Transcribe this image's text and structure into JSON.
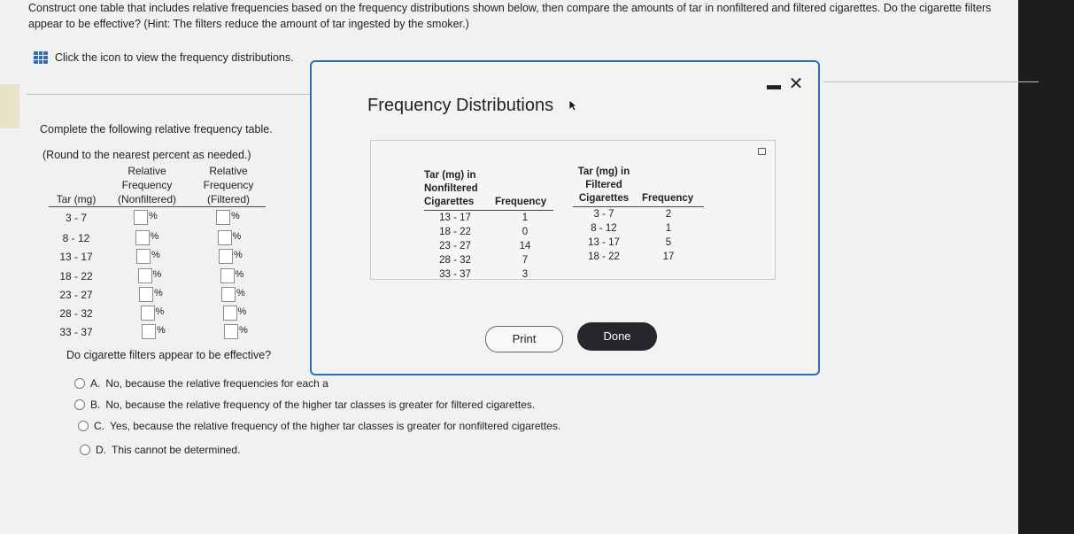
{
  "question": {
    "line1": "Construct one table that includes relative frequencies based on the frequency distributions shown below, then compare the amounts of tar in nonfiltered and filtered cigarettes. Do the cigarette filters",
    "line2": "appear to be effective? (Hint: The filters reduce the amount of tar ingested by the smoker.)"
  },
  "icon_link": {
    "icon": "table-icon",
    "text": "Click the icon to view the frequency distributions."
  },
  "instruction": "Complete the following relative frequency table.",
  "round_note": "(Round to the nearest percent as needed.)",
  "rel_table": {
    "headers": {
      "tar": "Tar (mg)",
      "nonfiltered": [
        "Relative",
        "Frequency",
        "(Nonfiltered)"
      ],
      "filtered": [
        "Relative",
        "Frequency",
        "(Filtered)"
      ]
    },
    "percent_sign": "%",
    "rows": [
      "3 - 7",
      "8 - 12",
      "13 - 17",
      "18 - 22",
      "23 - 27",
      "28 - 32",
      "33 - 37"
    ]
  },
  "effective_question": "Do cigarette filters appear to be effective?",
  "options": [
    {
      "letter": "A.",
      "text": "No, because the relative frequencies for each a"
    },
    {
      "letter": "B.",
      "text": "No, because the relative frequency of the higher tar classes is greater for filtered cigarettes."
    },
    {
      "letter": "C.",
      "text": "Yes, because the relative frequency of the higher tar classes is greater for nonfiltered cigarettes."
    },
    {
      "letter": "D.",
      "text": "This cannot be determined."
    }
  ],
  "dialog": {
    "title": "Frequency Distributions",
    "minimize": "▬",
    "close": "✕",
    "nonfiltered": {
      "header": [
        "Tar (mg) in",
        "Nonfiltered",
        "Cigarettes"
      ],
      "freq_header": "Frequency",
      "rows": [
        {
          "class": "13 - 17",
          "freq": "1"
        },
        {
          "class": "18 - 22",
          "freq": "0"
        },
        {
          "class": "23 - 27",
          "freq": "14"
        },
        {
          "class": "28 - 32",
          "freq": "7"
        },
        {
          "class": "33 - 37",
          "freq": "3"
        }
      ]
    },
    "filtered": {
      "header": [
        "Tar (mg) in",
        "Filtered",
        "Cigarettes"
      ],
      "freq_header": "Frequency",
      "rows": [
        {
          "class": "3 - 7",
          "freq": "2"
        },
        {
          "class": "8 - 12",
          "freq": "1"
        },
        {
          "class": "13 - 17",
          "freq": "5"
        },
        {
          "class": "18 - 22",
          "freq": "17"
        }
      ]
    },
    "print_label": "Print",
    "done_label": "Done"
  },
  "colors": {
    "accent": "#2f6db5",
    "done_bg": "#25272b"
  }
}
